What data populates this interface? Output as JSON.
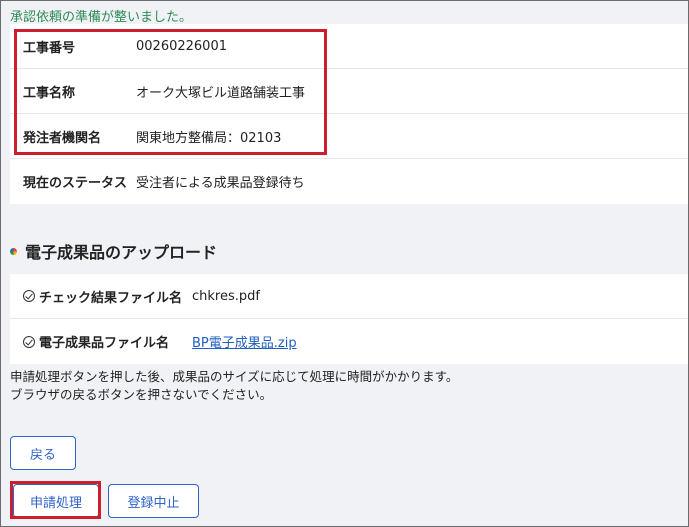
{
  "status_message": "承認依頼の準備が整いました。",
  "project_info": {
    "rows": [
      {
        "label": "工事番号",
        "value": "00260226001"
      },
      {
        "label": "工事名称",
        "value": "オーク大塚ビル道路舗装工事"
      },
      {
        "label": "発注者機関名",
        "value": "関東地方整備局：02103"
      },
      {
        "label": "現在のステータス",
        "value": "受注者による成果品登録待ち"
      }
    ]
  },
  "upload": {
    "title": "電子成果品のアップロード",
    "rows": [
      {
        "label": "チェック結果ファイル名",
        "value": "chkres.pdf"
      },
      {
        "label": "電子成果品ファイル名",
        "value": "BP電子成果品.zip"
      }
    ]
  },
  "notice": {
    "line1": "申請処理ボタンを押した後、成果品のサイズに応じて処理に時間がかかります。",
    "line2": "ブラウザの戻るボタンを押さないでください。"
  },
  "buttons": {
    "back": "戻る",
    "apply": "申請処理",
    "cancel": "登録中止"
  },
  "colors": {
    "accent": "#2f63c9",
    "highlight": "#cc1f2d",
    "success_text": "#2e8b57"
  }
}
